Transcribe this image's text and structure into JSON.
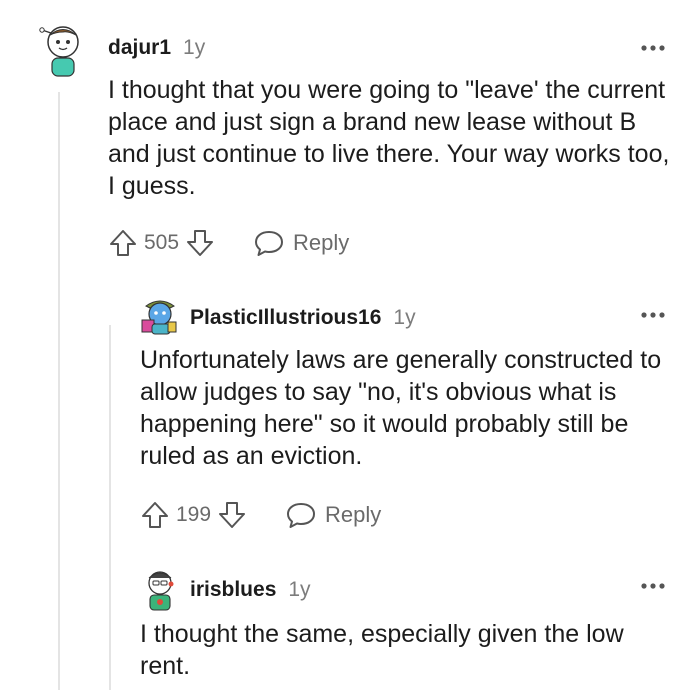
{
  "comments": [
    {
      "username": "dajur1",
      "age": "1y",
      "text": "I thought that you were going to \"leave' the current place and just sign a brand new lease without B and just continue to live there. Your way works too, I guess.",
      "score": "505",
      "reply_label": "Reply"
    },
    {
      "username": "PlasticIllustrious16",
      "age": "1y",
      "text": "Unfortunately laws are generally constructed to allow judges to say \"no, it's obvious what is happening here\" so it would probably still be ruled as an eviction.",
      "score": "199",
      "reply_label": "Reply"
    },
    {
      "username": "irisblues",
      "age": "1y",
      "text": "I thought the same, especially given the low rent."
    }
  ],
  "icons": {
    "upvote": "arrow-up-outline-icon",
    "downvote": "arrow-down-outline-icon",
    "reply": "speech-bubble-icon",
    "more": "more-horizontal-icon"
  },
  "colors": {
    "text": "#1c1c1c",
    "muted": "#7c7c7c",
    "thread_line": "#e4e4e4"
  }
}
